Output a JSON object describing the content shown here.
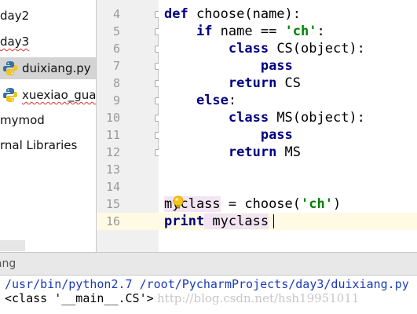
{
  "project_tree": {
    "items": [
      {
        "label": "day2",
        "error": false,
        "icon": "none",
        "selected": false
      },
      {
        "label": "day3",
        "error": true,
        "icon": "none",
        "selected": false
      },
      {
        "label": "duixiang.py",
        "error": false,
        "icon": "python-file-icon",
        "selected": true
      },
      {
        "label": "xuexiao_gua",
        "error": true,
        "icon": "python-file-icon",
        "selected": false
      },
      {
        "label": "mymod",
        "error": false,
        "icon": "none",
        "selected": false
      },
      {
        "label": "rnal Libraries",
        "error": false,
        "icon": "none",
        "selected": false
      }
    ]
  },
  "editor": {
    "line_numbers": [
      "4",
      "5",
      "6",
      "7",
      "8",
      "9",
      "10",
      "11",
      "12",
      "13",
      "14",
      "15",
      "16"
    ],
    "current_line": "16",
    "code": {
      "l4": {
        "kw": "def",
        "rest": " choose(name):"
      },
      "l5": {
        "kw": "if",
        "mid": " name == ",
        "str": "'ch'",
        "end": ":"
      },
      "l6": {
        "kw": "class",
        "rest": " CS(object):"
      },
      "l7": {
        "kw": "pass"
      },
      "l8": {
        "kw": "return",
        "rest": " CS"
      },
      "l9": {
        "kw": "else",
        "rest": ":"
      },
      "l10": {
        "kw": "class",
        "rest": " MS(object):"
      },
      "l11": {
        "kw": "pass"
      },
      "l12": {
        "kw": "return",
        "rest": " MS"
      },
      "l15": {
        "var": "myclass",
        "mid": " = choose(",
        "str": "'ch'",
        "end": ")"
      },
      "l16": {
        "kw": "print",
        "var": " myclass"
      }
    }
  },
  "run_panel": {
    "title": "iang"
  },
  "console": {
    "command": "/usr/bin/python2.7 /root/PycharmProjects/day3/duixiang.py",
    "output": "<class '__main__.CS'>",
    "watermark": "http://blog.csdn.net/hsh19951011"
  },
  "colors": {
    "keyword": "#000080",
    "string": "#008000",
    "current_line": "#fffae3",
    "console_command": "#1a3bb8"
  }
}
